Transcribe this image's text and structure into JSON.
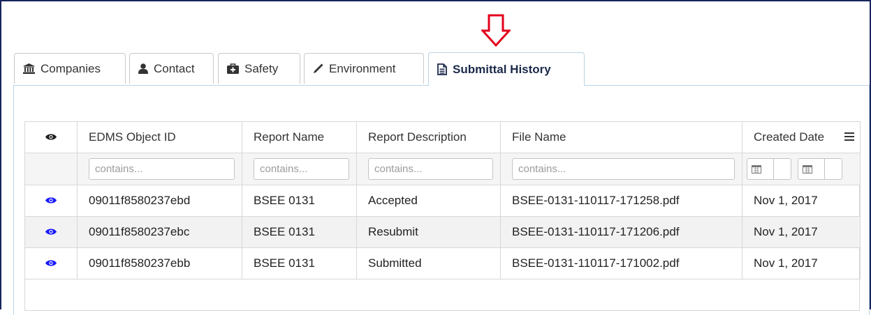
{
  "tabs": [
    {
      "label": "Companies",
      "icon": "bank-icon",
      "active": false
    },
    {
      "label": "Contact",
      "icon": "user-icon",
      "active": false
    },
    {
      "label": "Safety",
      "icon": "medkit-icon",
      "active": false
    },
    {
      "label": "Environment",
      "icon": "eyedropper-icon",
      "active": false
    },
    {
      "label": "Submittal History",
      "icon": "file-text-icon",
      "active": true
    }
  ],
  "grid": {
    "columns": [
      "EDMS Object ID",
      "Report Name",
      "Report Description",
      "File Name",
      "Created Date"
    ],
    "filter_placeholder": "contains...",
    "rows": [
      {
        "edms_id": "09011f8580237ebd",
        "report_name": "BSEE 0131",
        "description": "Accepted",
        "file_name": "BSEE-0131-110117-171258.pdf",
        "created": "Nov 1, 2017"
      },
      {
        "edms_id": "09011f8580237ebc",
        "report_name": "BSEE 0131",
        "description": "Resubmit",
        "file_name": "BSEE-0131-110117-171206.pdf",
        "created": "Nov 1, 2017"
      },
      {
        "edms_id": "09011f8580237ebb",
        "report_name": "BSEE 0131",
        "description": "Submitted",
        "file_name": "BSEE-0131-110117-171002.pdf",
        "created": "Nov 1, 2017"
      }
    ]
  },
  "colors": {
    "accent_eye": "#1a1aff",
    "arrow": "#e3001b",
    "frame": "#16255c"
  }
}
